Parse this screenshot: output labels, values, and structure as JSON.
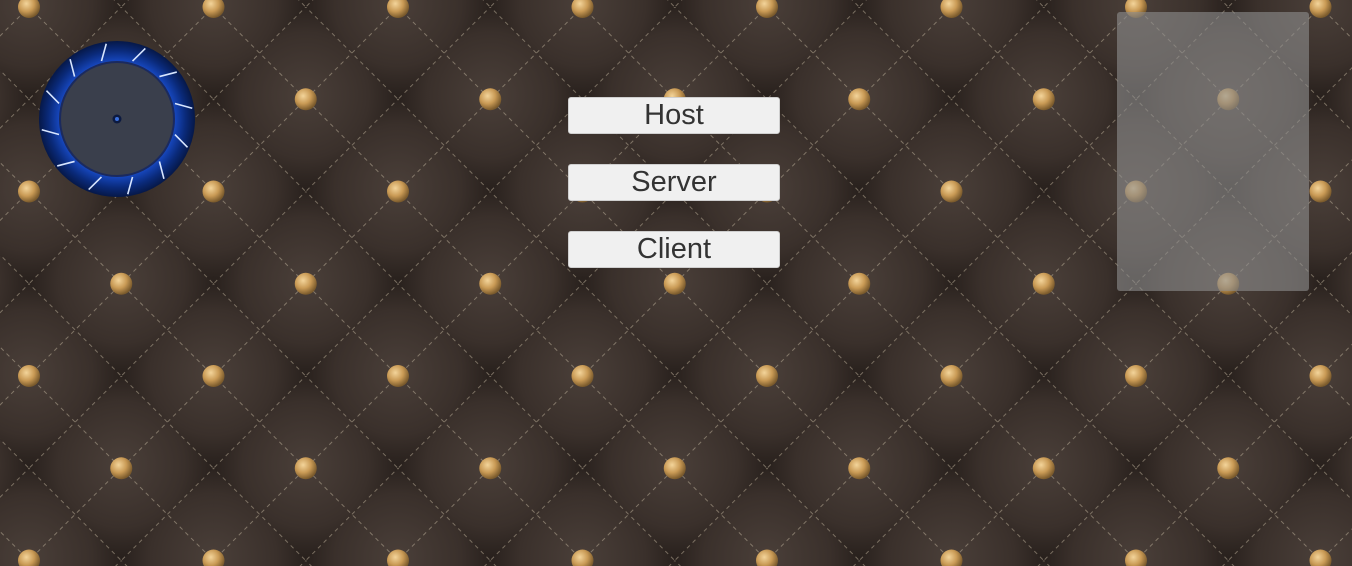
{
  "colors": {
    "leather": "#3a302b",
    "stud": "#c99a55",
    "stitch": "#b8ab95",
    "button_bg": "#f0f0f0",
    "button_text": "#333333",
    "wheel_ring": "#0a2a7a",
    "wheel_hub": "#3a3f4c",
    "panel": "#8c8c8c"
  },
  "menu": {
    "host_label": "Host",
    "server_label": "Server",
    "client_label": "Client"
  }
}
